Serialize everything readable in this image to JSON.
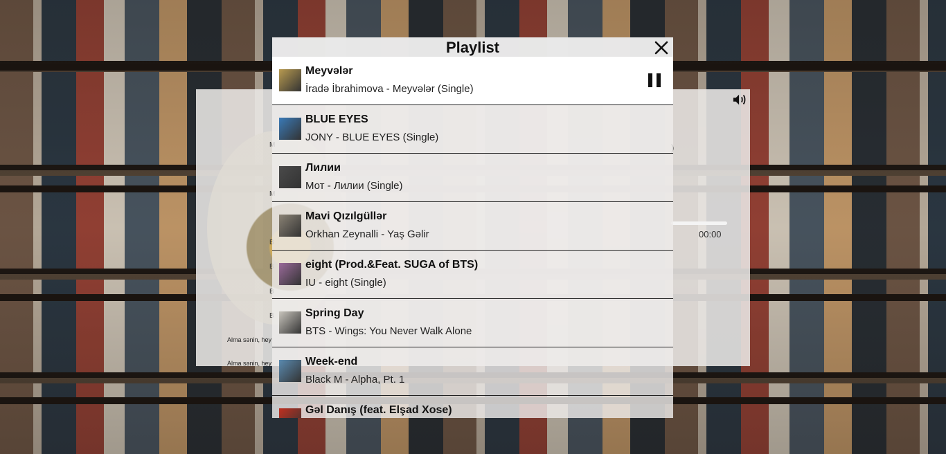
{
  "playlist": {
    "title": "Playlist",
    "close_icon": "close-icon",
    "pause_icon": "pause-icon",
    "tracks": [
      {
        "title": "Meyvələr",
        "subtitle": "İradə İbrahimova - Meyvələr (Single)",
        "active": true,
        "thumb_color": "#b89a50"
      },
      {
        "title": "BLUE EYES",
        "subtitle": "JONY - BLUE EYES (Single)",
        "active": false,
        "thumb_color": "#3a7ab8"
      },
      {
        "title": "Лилии",
        "subtitle": "Мот - Лилии (Single)",
        "active": false,
        "thumb_color": "#4a4a4a"
      },
      {
        "title": "Mavi Qızılgüllər",
        "subtitle": "Orkhan Zeynalli - Yaş Gəlir",
        "active": false,
        "thumb_color": "#8a8274"
      },
      {
        "title": "eight (Prod.&Feat. SUGA of BTS)",
        "subtitle": "IU - eight (Single)",
        "active": false,
        "thumb_color": "#9a6a9a"
      },
      {
        "title": "Spring Day",
        "subtitle": "BTS - Wings: You Never Walk Alone",
        "active": false,
        "thumb_color": "#c8c4bc"
      },
      {
        "title": "Week-end",
        "subtitle": "Black M - Alpha, Pt. 1",
        "active": false,
        "thumb_color": "#5a8ab0"
      },
      {
        "title": "Gəl Danış (feat. Elşad Xose)",
        "subtitle": "",
        "active": false,
        "thumb_color": "#c03020"
      }
    ]
  },
  "player": {
    "time": "00:00",
    "partial_text": ")",
    "volume_icon": "volume-icon",
    "side_letters": [
      "M",
      "M",
      "B",
      "B",
      "B",
      "B"
    ],
    "lyrics": [
      "Alma sənin, hey",
      "Alma sənin, hey"
    ],
    "progress_fraction": 0
  }
}
